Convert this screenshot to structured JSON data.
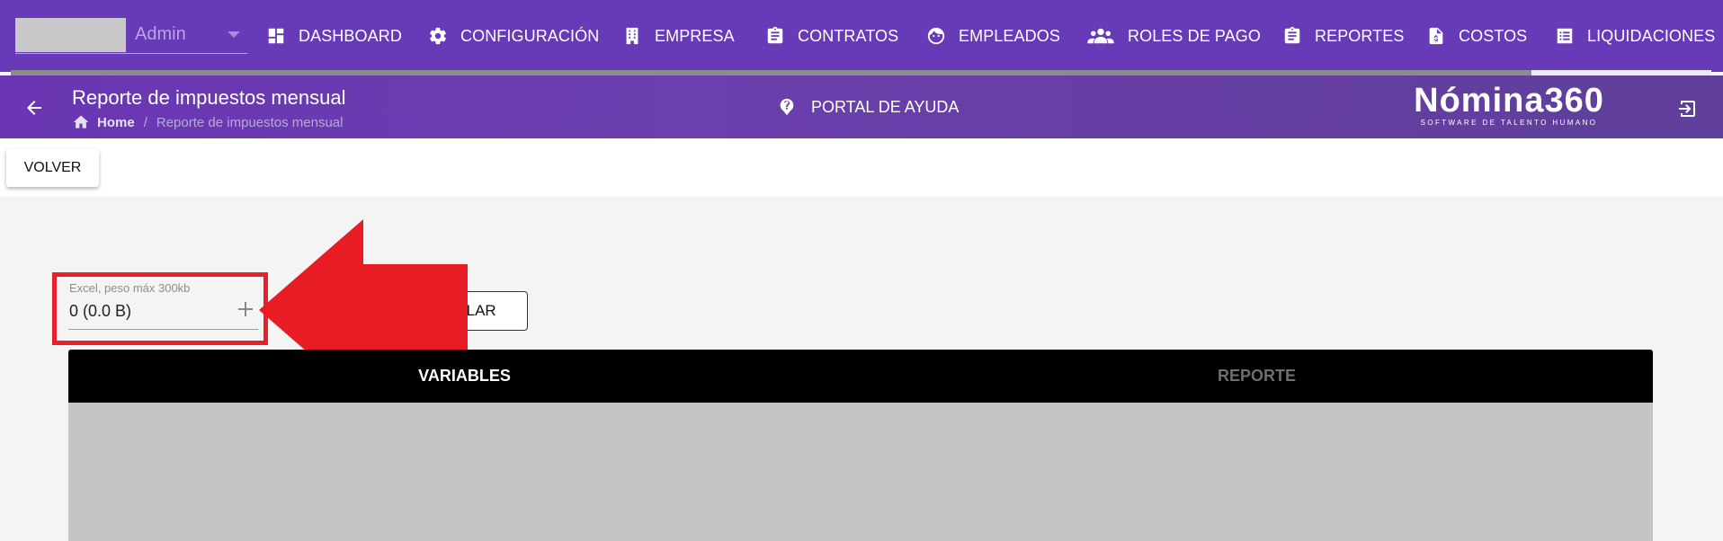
{
  "user": {
    "name": "Admin"
  },
  "nav": {
    "items": [
      {
        "label": "DASHBOARD",
        "icon": "dashboard-icon"
      },
      {
        "label": "CONFIGURACIÓN",
        "icon": "gear-icon"
      },
      {
        "label": "EMPRESA",
        "icon": "building-icon"
      },
      {
        "label": "CONTRATOS",
        "icon": "clipboard-icon"
      },
      {
        "label": "EMPLEADOS",
        "icon": "face-icon"
      },
      {
        "label": "ROLES DE PAGO",
        "icon": "people-icon"
      },
      {
        "label": "REPORTES",
        "icon": "clipboard-icon"
      },
      {
        "label": "COSTOS",
        "icon": "dollar-file-icon"
      },
      {
        "label": "LIQUIDACIONES",
        "icon": "list-icon"
      }
    ]
  },
  "header": {
    "title": "Reporte de impuestos mensual",
    "breadcrumb": {
      "home": "Home",
      "separator": "/",
      "current": "Reporte de impuestos mensual"
    },
    "help_label": "PORTAL DE AYUDA",
    "brand_name": "Nómina360",
    "brand_tagline": "SOFTWARE DE TALENTO HUMANO"
  },
  "toolbar": {
    "back_label": "VOLVER"
  },
  "upload": {
    "label": "Excel, peso máx 300kb",
    "value": "0 (0.0 B)",
    "cancel_label": "CELAR"
  },
  "tabs": [
    {
      "label": "VARIABLES",
      "active": true
    },
    {
      "label": "REPORTE",
      "active": false
    }
  ],
  "colors": {
    "primary": "#673ab7",
    "highlight": "#e8202a",
    "tab_bar": "#000000",
    "panel": "#c4c4c4"
  }
}
